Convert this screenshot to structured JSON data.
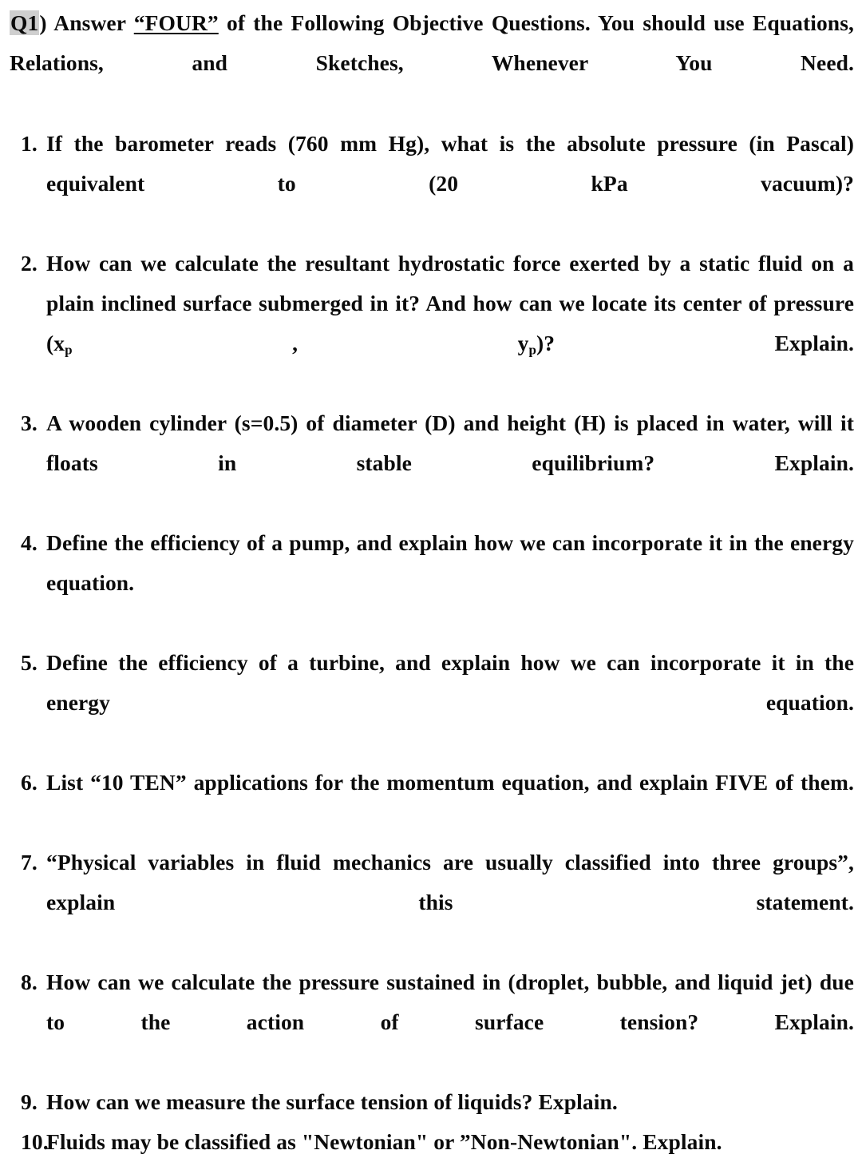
{
  "document": {
    "type": "exam-question-sheet",
    "background_color": "#ffffff",
    "text_color": "#0b0b0b",
    "highlight_color": "#cfcfcf"
  },
  "header": {
    "question_tag": "Q1",
    "tag_suffix": ")",
    "text_before_emphasis": " Answer ",
    "emphasis": "“FOUR”",
    "text_after_emphasis": " of the Following Objective Questions. You should use Equations, Relations, and Sketches, Whenever You Need."
  },
  "questions": [
    {
      "number": "1.",
      "text": "If the barometer reads (760 mm Hg), what is the absolute pressure (in Pascal) equivalent to (20 kPa vacuum)?"
    },
    {
      "number": "2.",
      "text_part_1": "How can we calculate the resultant hydrostatic force exerted by a static fluid on a plain inclined surface submerged in it? And how can we locate its center of pressure (x",
      "subscript_1": "p",
      "text_part_2": " , y",
      "subscript_2": "p",
      "text_part_3": ")? Explain."
    },
    {
      "number": "3.",
      "text": "A wooden cylinder (s=0.5) of diameter (D) and height (H) is placed in water, will it floats in stable equilibrium? Explain."
    },
    {
      "number": "4.",
      "text": "Define the efficiency of a pump, and explain how we can incorporate it in the energy equation."
    },
    {
      "number": "5.",
      "text": "Define the efficiency of a turbine, and explain how we can incorporate it in the energy equation."
    },
    {
      "number": "6.",
      "text": "List “10 TEN” applications for the momentum equation, and explain FIVE of them."
    },
    {
      "number": "7.",
      "text": "“Physical variables in fluid mechanics are usually classified into three groups”, explain this statement."
    },
    {
      "number": "8.",
      "text": "How can we calculate the pressure sustained in (droplet, bubble, and liquid jet) due to the action of surface tension? Explain."
    },
    {
      "number": "9.",
      "text": "How can we measure the surface tension of liquids? Explain."
    },
    {
      "number": "10.",
      "text": "Fluids may be classified as \"Newtonian\" or ”Non-Newtonian\". Explain."
    }
  ]
}
